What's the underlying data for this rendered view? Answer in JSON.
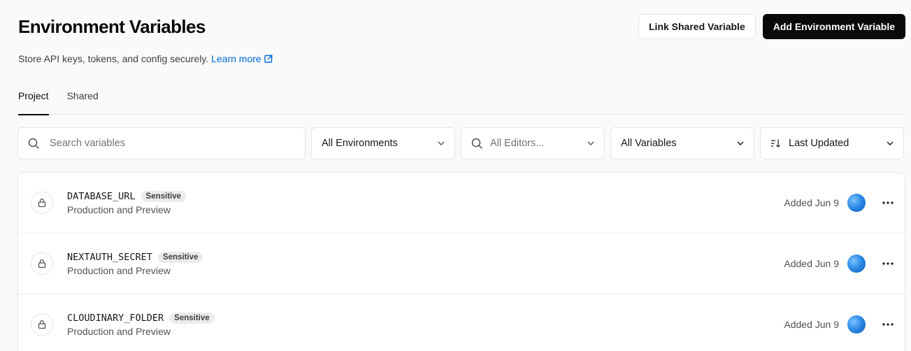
{
  "header": {
    "title": "Environment Variables",
    "link_shared_label": "Link Shared Variable",
    "add_label": "Add Environment Variable"
  },
  "subtitle": {
    "text": "Store API keys, tokens, and config securely.",
    "link_label": "Learn more"
  },
  "tabs": [
    {
      "label": "Project",
      "active": true
    },
    {
      "label": "Shared",
      "active": false
    }
  ],
  "filters": {
    "search_placeholder": "Search variables",
    "environments": "All Environments",
    "editors_placeholder": "All Editors...",
    "variables": "All Variables",
    "sort": "Last Updated"
  },
  "variables": [
    {
      "name": "DATABASE_URL",
      "badge": "Sensitive",
      "env": "Production and Preview",
      "added": "Added Jun 9"
    },
    {
      "name": "NEXTAUTH_SECRET",
      "badge": "Sensitive",
      "env": "Production and Preview",
      "added": "Added Jun 9"
    },
    {
      "name": "CLOUDINARY_FOLDER",
      "badge": "Sensitive",
      "env": "Production and Preview",
      "added": "Added Jun 9"
    }
  ],
  "colors": {
    "accent_link": "#0068d6",
    "primary_button": "#0a0a0a",
    "badge_bg": "#ebebeb"
  },
  "icons": {
    "search": "search-icon",
    "chevron": "chevron-down-icon",
    "sort": "sort-icon",
    "lock": "lock-icon",
    "more": "more-icon",
    "external": "external-link-icon"
  }
}
